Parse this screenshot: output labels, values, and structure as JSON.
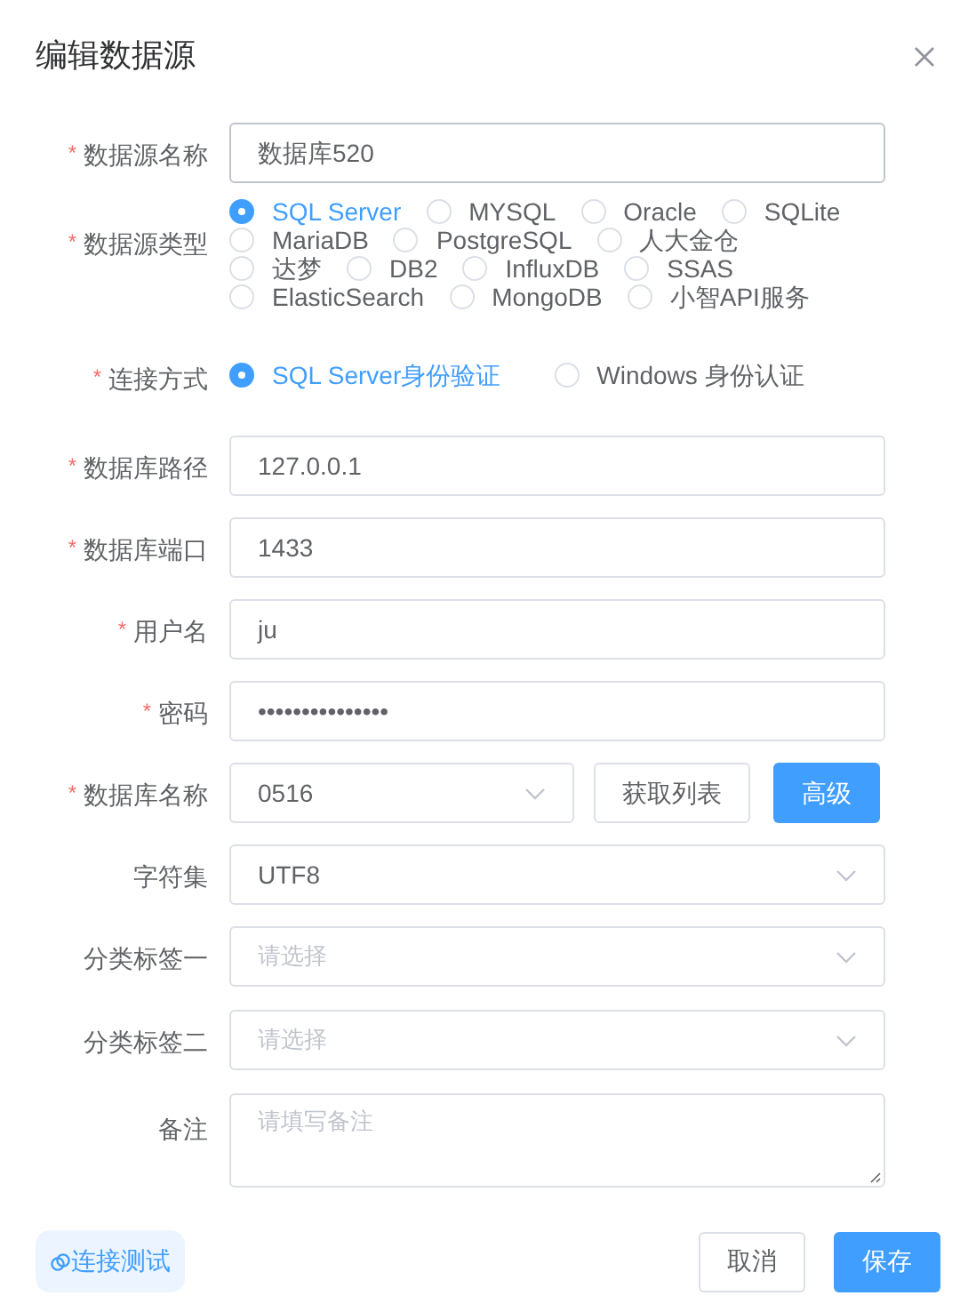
{
  "dialog": {
    "title": "编辑数据源"
  },
  "fields": [
    {
      "kind": "text",
      "mark": "*",
      "label": "数据源名称",
      "value": "数据库520"
    },
    {
      "kind": "radio",
      "mark": "*",
      "label": "数据源类型",
      "options": [
        {
          "label": "SQL Server",
          "selected": true
        },
        {
          "label": "MYSQL",
          "selected": false
        },
        {
          "label": "Oracle",
          "selected": false
        },
        {
          "label": "SQLite",
          "selected": false
        },
        {
          "label": "MariaDB",
          "selected": false
        },
        {
          "label": "PostgreSQL",
          "selected": false
        },
        {
          "label": "人大金仓",
          "selected": false
        },
        {
          "label": "达梦",
          "selected": false
        },
        {
          "label": "DB2",
          "selected": false
        },
        {
          "label": "InfluxDB",
          "selected": false
        },
        {
          "label": "SSAS",
          "selected": false
        },
        {
          "label": "ElasticSearch",
          "selected": false
        },
        {
          "label": "MongoDB",
          "selected": false
        },
        {
          "label": "小智API服务",
          "selected": false
        }
      ]
    },
    {
      "kind": "radio",
      "mark": "*",
      "label": "连接方式",
      "options": [
        {
          "label": "SQL Server身份验证",
          "selected": true
        },
        {
          "label": "Windows 身份认证",
          "selected": false
        }
      ]
    },
    {
      "kind": "text",
      "mark": "*",
      "label": "数据库路径",
      "value": "127.0.0.1"
    },
    {
      "kind": "text",
      "mark": "*",
      "label": "数据库端口",
      "value": "1433"
    },
    {
      "kind": "text",
      "mark": "*",
      "label": "用户名",
      "value": "ju"
    },
    {
      "kind": "password",
      "mark": "*",
      "label": "密码",
      "value": "•••••••••••••••"
    },
    {
      "kind": "select",
      "mark": "*",
      "label": "数据库名称",
      "value": "0516",
      "buttons": [
        {
          "label": "获取列表",
          "primary": false
        },
        {
          "label": "高级",
          "primary": true
        }
      ]
    },
    {
      "kind": "select",
      "label": "字符集",
      "value": "UTF8"
    },
    {
      "kind": "select",
      "label": "分类标签一",
      "placeholder": "请选择"
    },
    {
      "kind": "select",
      "label": "分类标签二",
      "placeholder": "请选择"
    },
    {
      "kind": "textarea",
      "label": "备注",
      "placeholder": "请填写备注"
    }
  ],
  "footer": {
    "test_button": "连接测试",
    "cancel_button": "取消",
    "save_button": "保存"
  }
}
